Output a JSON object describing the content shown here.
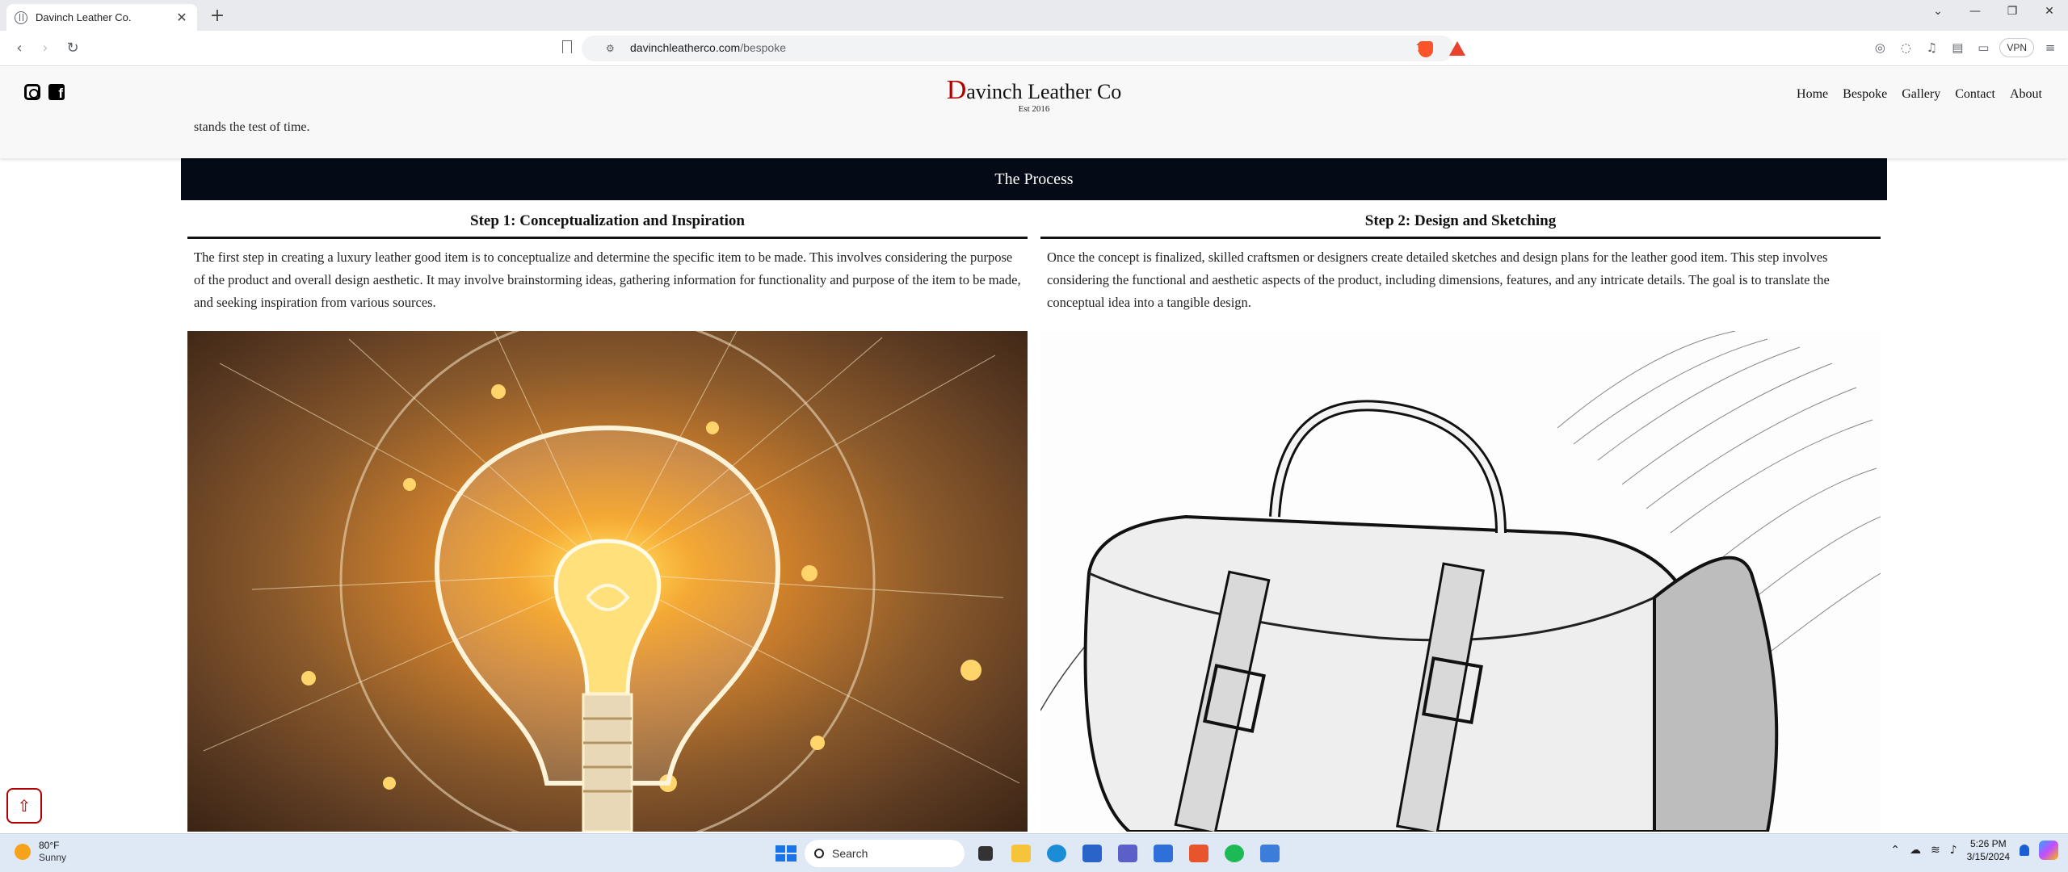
{
  "browser": {
    "tab_title": "Davinch Leather Co.",
    "tab_close": "✕",
    "new_tab": "+",
    "window_controls": [
      "⌄",
      "—",
      "❐",
      "✕"
    ],
    "url_domain": "davinchleatherco.com",
    "url_path": "/bespoke",
    "vpn_label": "VPN",
    "icons": [
      "back-icon",
      "forward-icon",
      "reload-icon",
      "bookmark-icon",
      "site-info-icon",
      "share-icon",
      "brave-shields-icon",
      "brave-rewards-icon",
      "wallet-icon",
      "chat-icon",
      "music-icon",
      "extensions-icon",
      "sidebar-icon",
      "menu-icon"
    ]
  },
  "site": {
    "logo_initial": "D",
    "logo_rest": "avinch Leather Co",
    "established": "Est 2016",
    "nav": [
      "Home",
      "Bespoke",
      "Gallery",
      "Contact",
      "About"
    ],
    "intro_tail": "stands the test of time.",
    "section_title": "The Process",
    "steps": [
      {
        "title": "Step 1: Conceptualization and Inspiration",
        "description": "The first step in creating a luxury leather good item is to conceptualize and determine the specific item to be made. This involves considering the purpose of the product and overall design aesthetic. It may involve brainstorming ideas, gathering information for functionality and purpose of the item to be made, and seeking inspiration from various sources.",
        "image": "light-bulb-illustration"
      },
      {
        "title": "Step 2: Design and Sketching",
        "description": "Once the concept is finalized, skilled craftsmen or designers create detailed sketches and design plans for the leather good item. This step involves considering the functional and aesthetic aspects of the product, including dimensions, features, and any intricate details. The goal is to translate the conceptual idea into a tangible design.",
        "image": "leather-bag-sketch"
      }
    ],
    "colors": {
      "logo_accent": "#b00000",
      "section_bar": "#040a16"
    }
  },
  "taskbar": {
    "temperature": "80°F",
    "condition": "Sunny",
    "search_label": "Search",
    "time": "5:26 PM",
    "date": "3/15/2024",
    "apps": [
      "task-view-icon",
      "file-explorer-icon",
      "edge-icon",
      "store-icon",
      "teams-icon",
      "app-icon",
      "brave-icon",
      "spotify-icon",
      "app-icon-2"
    ]
  }
}
